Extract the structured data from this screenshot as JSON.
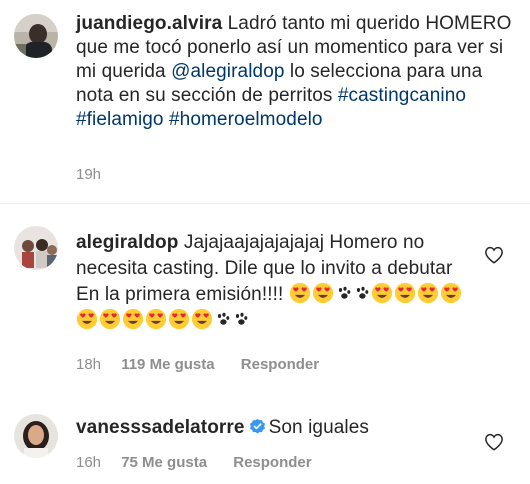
{
  "comments": [
    {
      "username": "juandiego.alvira",
      "text_1": " Ladró tanto mi querido HOMERO que me tocó ponerlo así un momentico para ver si mi querida ",
      "mention": "@alegiraldop",
      "text_2": " lo selecciona para una nota en su sección de perritos ",
      "hashtags": [
        "#castingcanino",
        "#fielamigo",
        "#homeroelmodelo"
      ],
      "time": "19h"
    },
    {
      "username": "alegiraldop",
      "text": " Jajajaajajajajajaj Homero no necesita casting. Dile que lo invito a debutar En la primera emisión!!!! ",
      "emoji_name": "heart-eyes-icon",
      "paw_name": "paw-prints-icon",
      "time": "18h",
      "likes": "119 Me gusta",
      "reply": "Responder"
    },
    {
      "username": "vanesssadelatorre",
      "verified_icon": "verified-badge-icon",
      "text": "Son iguales",
      "time": "16h",
      "likes": "75 Me gusta",
      "reply": "Responder"
    }
  ],
  "icons": {
    "like": "heart-outline-icon"
  },
  "colors": {
    "text": "#262626",
    "meta": "#8e8e8e",
    "link": "#00376b",
    "verified": "#3897f0"
  }
}
